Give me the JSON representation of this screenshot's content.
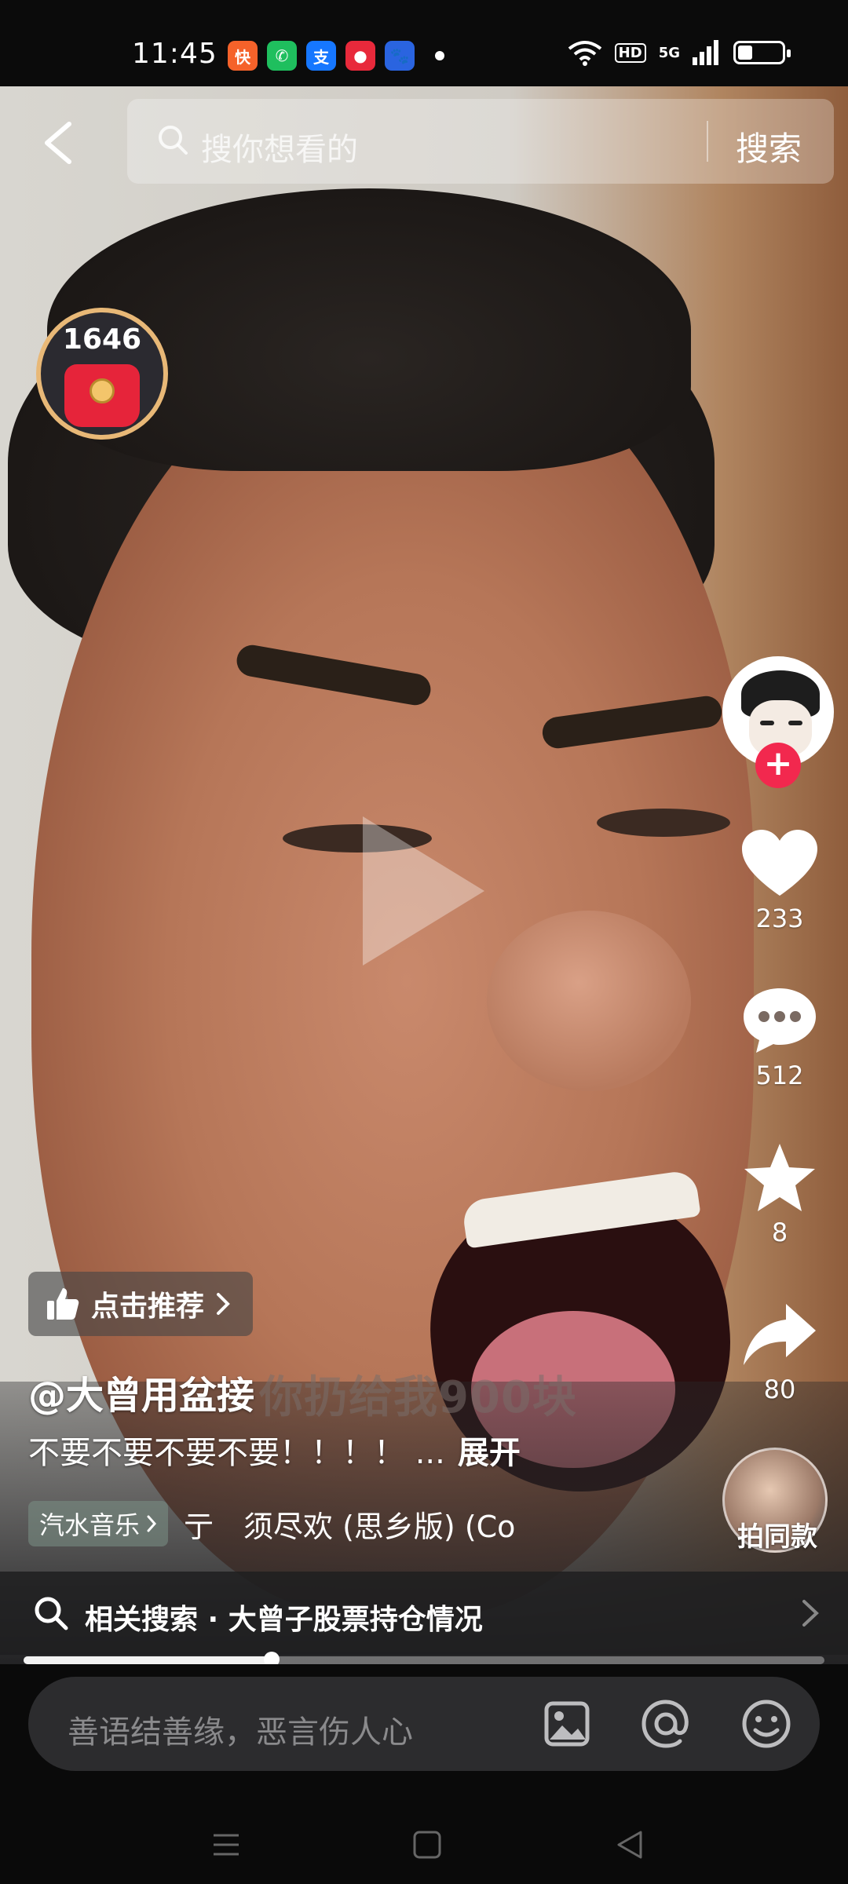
{
  "status_bar": {
    "time": "11:45",
    "apps": [
      {
        "icon": "kuaishou-icon",
        "color": "#f5622a"
      },
      {
        "icon": "phone-icon",
        "color": "#1fbf5e"
      },
      {
        "icon": "alipay-icon",
        "color": "#1677ff"
      },
      {
        "icon": "redpacket-app-icon",
        "color": "#e8293b"
      },
      {
        "icon": "baidu-icon",
        "color": "#2a64e0"
      }
    ],
    "hd_label": "HD",
    "network_label": "5G"
  },
  "top_bar": {
    "search_placeholder": "搜你想看的",
    "search_button": "搜索"
  },
  "red_packet": {
    "count": "1646"
  },
  "right_rail": {
    "like_count": "233",
    "comment_count": "512",
    "favorite_count": "8",
    "share_count": "80",
    "same_style_label": "拍同款"
  },
  "video_info": {
    "recommend_label": "点击推荐",
    "author": "@大曾用盆接",
    "subtitle": "你扔给我900块",
    "caption": "不要不要不要不要！！！！ ...",
    "caption_more": "展开",
    "music_tag": "汽水音乐",
    "music_name": "亍　须尽欢 (思乡版) (Co"
  },
  "related_search": {
    "text": "相关搜索 · 大曾子股票持仓情况"
  },
  "progress": {
    "fraction": 0.31
  },
  "comment_bar": {
    "placeholder": "善语结善缘，恶言伤人心"
  },
  "colors": {
    "accent": "#f2284e",
    "redpacket": "#e6243a",
    "gold": "#e8b877"
  }
}
